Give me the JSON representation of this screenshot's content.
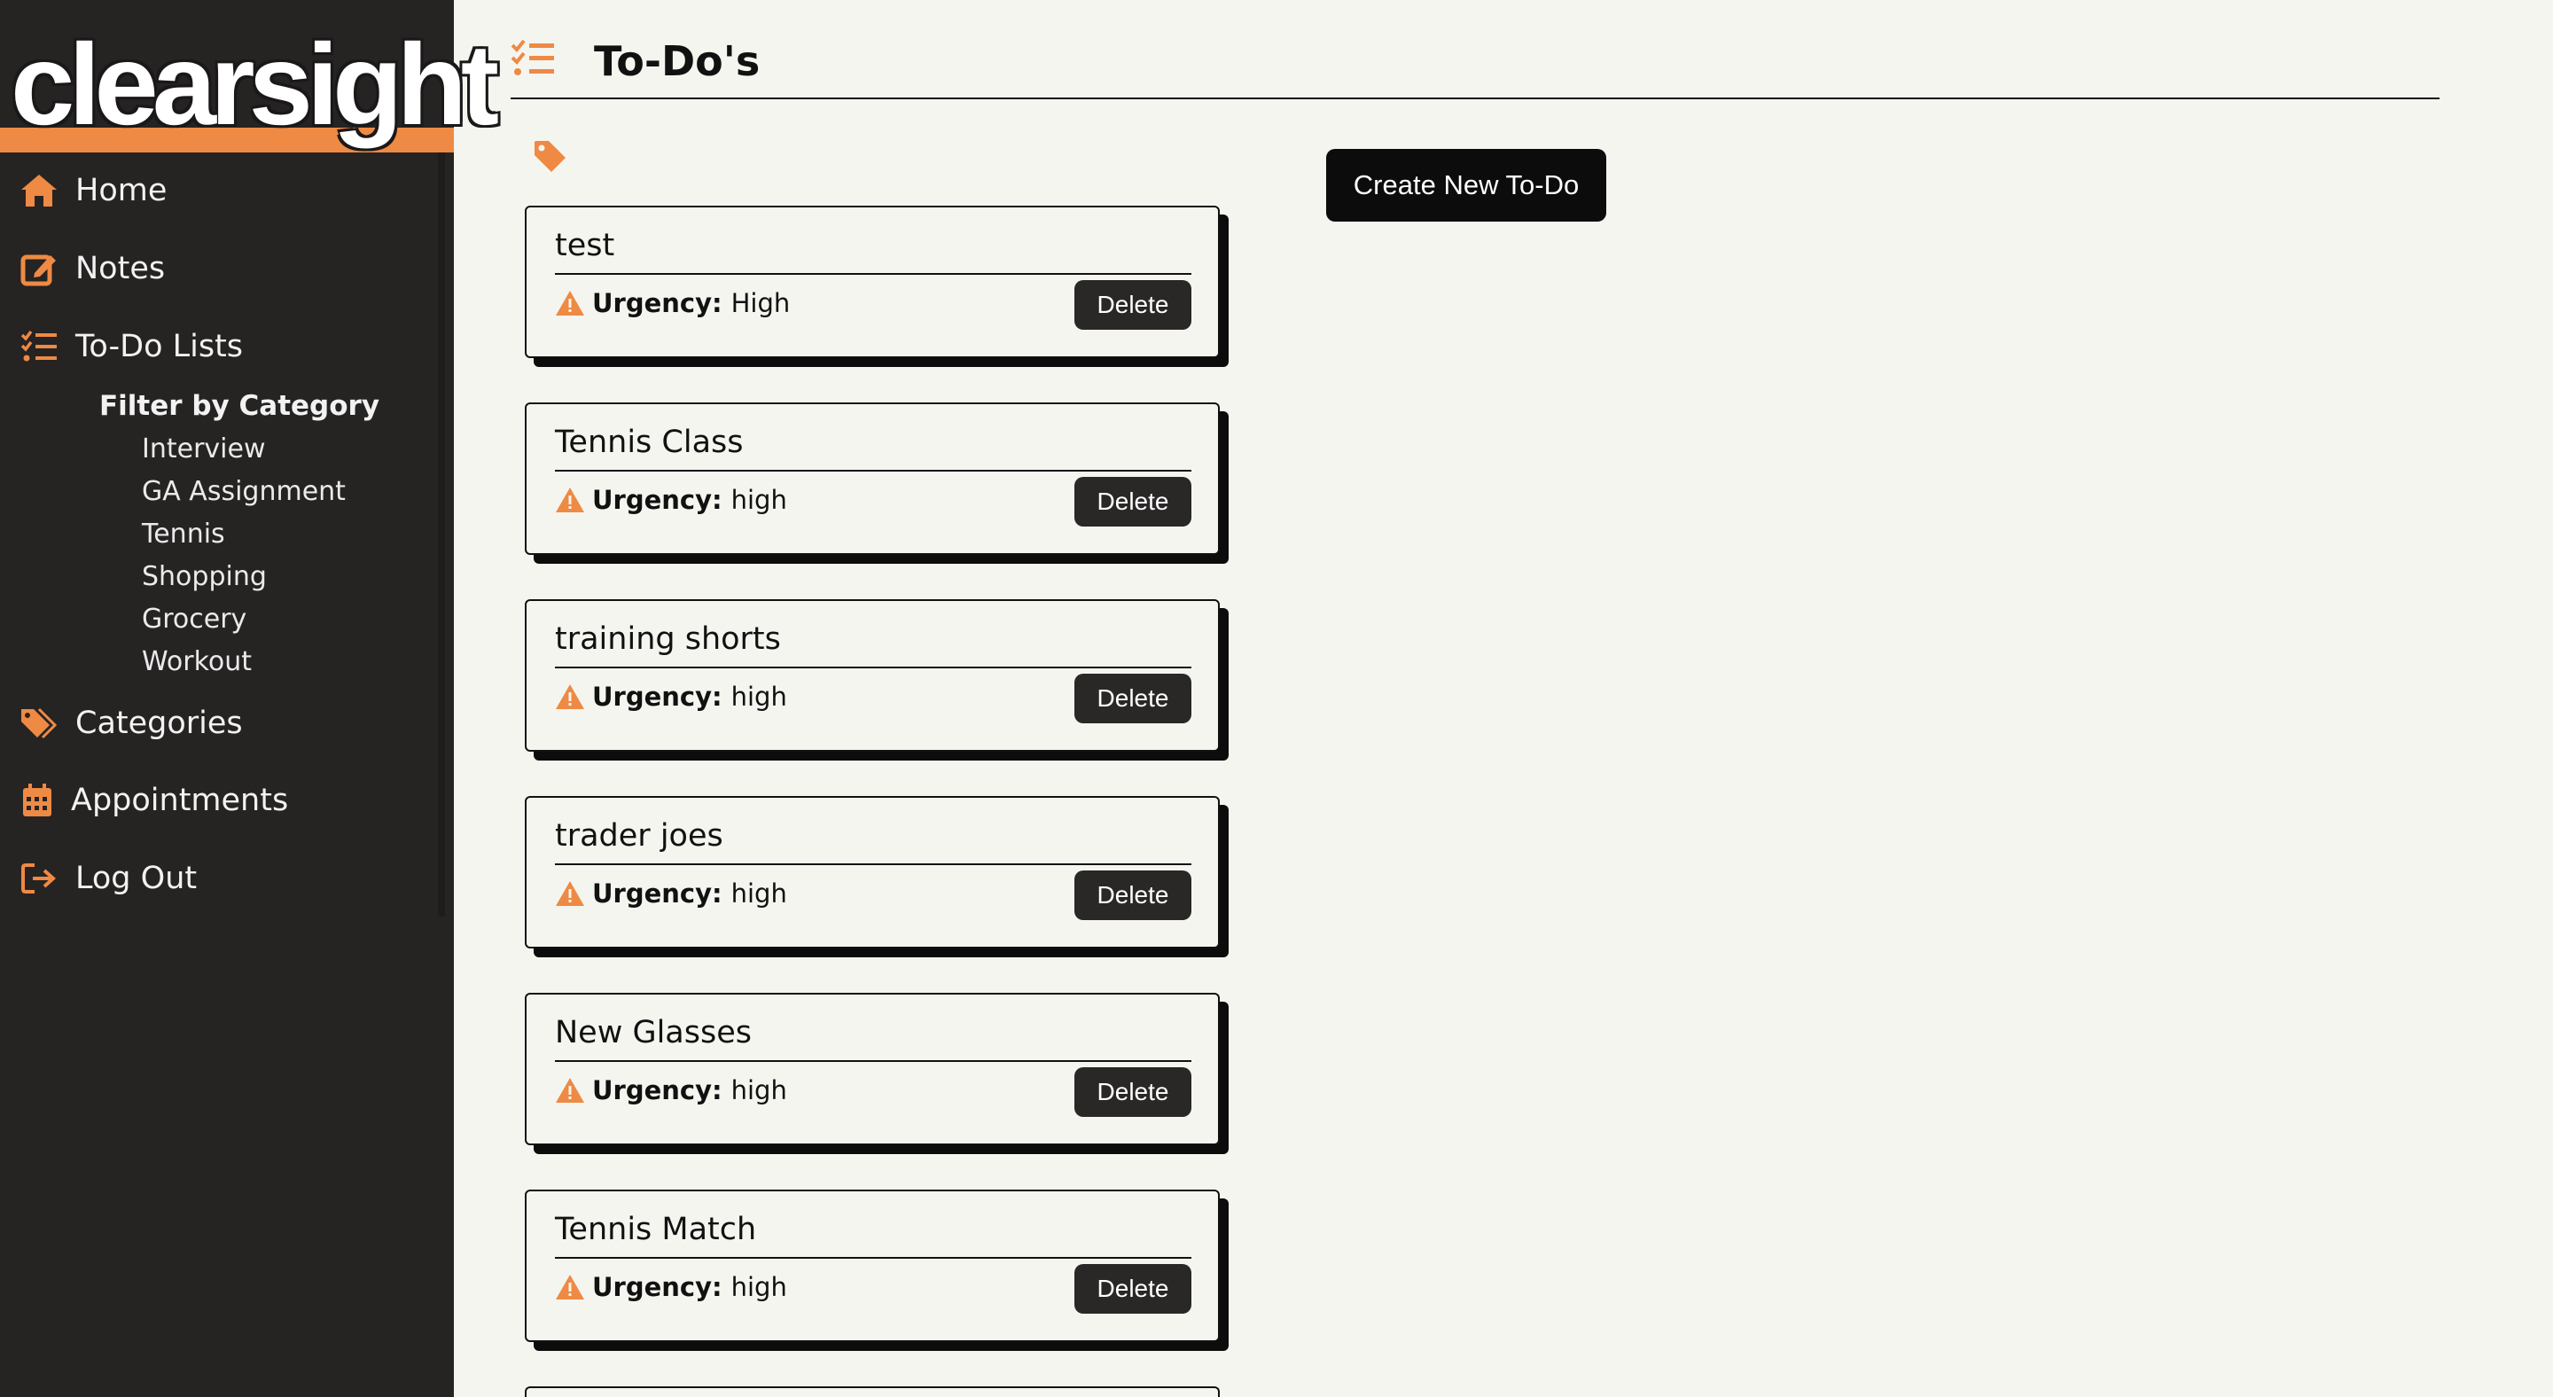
{
  "brand": {
    "logo_text": "clearsight"
  },
  "sidebar": {
    "nav": [
      {
        "label": "Home",
        "icon": "home-icon"
      },
      {
        "label": "Notes",
        "icon": "edit-icon"
      },
      {
        "label": "To-Do Lists",
        "icon": "list-check-icon"
      },
      {
        "label": "Categories",
        "icon": "tags-icon"
      },
      {
        "label": "Appointments",
        "icon": "calendar-icon"
      },
      {
        "label": "Log Out",
        "icon": "logout-icon"
      }
    ],
    "filter": {
      "heading": "Filter by Category",
      "items": [
        "Interview",
        "GA Assignment",
        "Tennis",
        "Shopping",
        "Grocery",
        "Workout"
      ]
    }
  },
  "main": {
    "title": "To-Do's",
    "create_button": "Create New To-Do",
    "urgency_label": "Urgency:",
    "delete_label": "Delete",
    "todos": [
      {
        "title": "test",
        "urgency": "High"
      },
      {
        "title": "Tennis Class",
        "urgency": "high"
      },
      {
        "title": "training shorts",
        "urgency": "high"
      },
      {
        "title": "trader joes",
        "urgency": "high"
      },
      {
        "title": "New Glasses",
        "urgency": "high"
      },
      {
        "title": "Tennis Match",
        "urgency": "high"
      }
    ]
  },
  "colors": {
    "accent": "#ee8a44",
    "sidebar_bg": "#262323",
    "page_bg": "#f5f5f0",
    "button_dark": "#0c0c0c"
  }
}
